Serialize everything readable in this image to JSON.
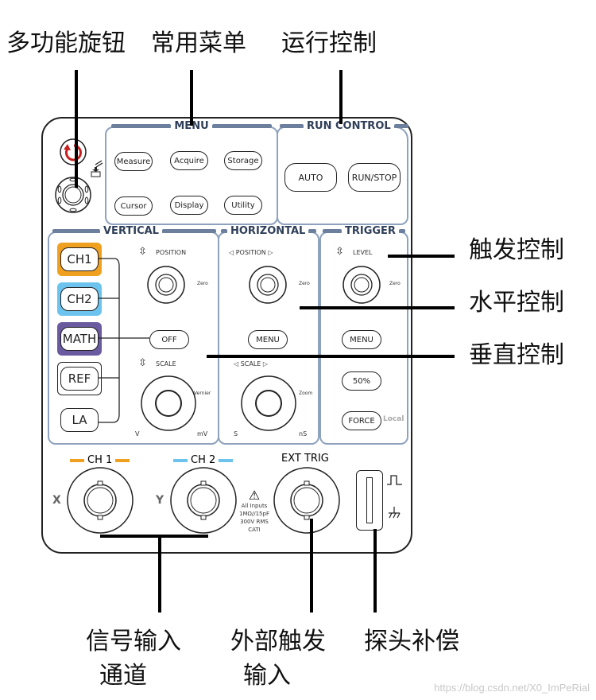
{
  "annotations": {
    "top": [
      "多功能旋钮",
      "常用菜单",
      "运行控制"
    ],
    "right": [
      "触发控制",
      "水平控制",
      "垂直控制"
    ],
    "bottom": [
      {
        "line1": "信号输入",
        "line2": "通道"
      },
      {
        "line1": "外部触发",
        "line2": "输入"
      },
      {
        "line1": "探头补偿",
        "line2": ""
      }
    ]
  },
  "panel": {
    "menu": {
      "title": "MENU",
      "buttons": [
        "Measure",
        "Acquire",
        "Storage",
        "Cursor",
        "Display",
        "Utility"
      ]
    },
    "run_control": {
      "title": "RUN CONTROL",
      "buttons": [
        "AUTO",
        "RUN/STOP"
      ]
    },
    "multifunction": {
      "push_label": ""
    },
    "vertical": {
      "title": "VERTICAL",
      "channels": [
        {
          "label": "CH1",
          "color": "#f0a020"
        },
        {
          "label": "CH2",
          "color": "#6cc4ee"
        },
        {
          "label": "MATH",
          "color": "#6a5aa0"
        },
        {
          "label": "REF",
          "color": "#ffffff"
        },
        {
          "label": "LA",
          "color": "#ffffff"
        }
      ],
      "position_label": "POSITION",
      "off_label": "OFF",
      "scale_label": "SCALE",
      "zero_label": "Zero",
      "vernier_label": "Vernier",
      "scale_left": "V",
      "scale_right": "mV"
    },
    "horizontal": {
      "title": "HORIZONTAL",
      "position_label": "POSITION",
      "menu_label": "MENU",
      "scale_label": "SCALE",
      "zero_label": "Zero",
      "zoom_label": "Zoom",
      "scale_left": "S",
      "scale_right": "nS"
    },
    "trigger": {
      "title": "TRIGGER",
      "level_label": "LEVEL",
      "zero_label": "Zero",
      "menu_label": "MENU",
      "fifty_label": "50%",
      "force_label": "FORCE",
      "local_label": "Local"
    },
    "inputs": {
      "ch1_label": "CH 1",
      "ch2_label": "CH 2",
      "ext_label": "EXT TRIG",
      "x_label": "X",
      "y_label": "Y",
      "warning": [
        "All Inputs",
        "1MΩ//15pF",
        "300V RMS",
        "CATⅠ"
      ],
      "ch1_color": "#f0a020",
      "ch2_color": "#6cc4ee"
    }
  },
  "watermark": "https://blog.csdn.net/X0_ImPeRial"
}
